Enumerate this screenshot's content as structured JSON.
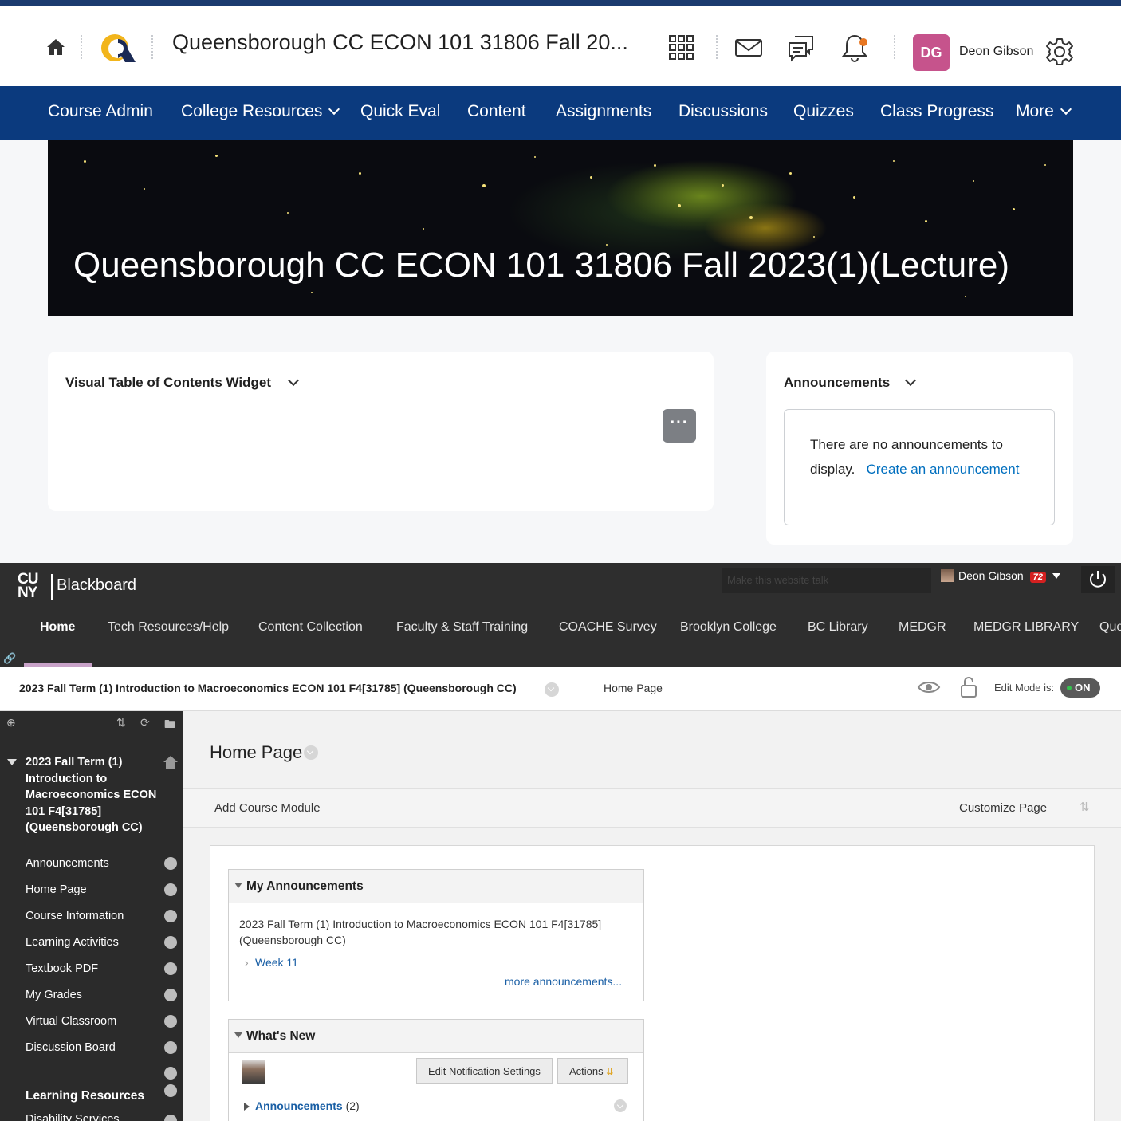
{
  "d2l": {
    "course_title": "Queensborough CC ECON 101 31806 Fall 20...",
    "user_initials": "DG",
    "user_name": "Deon Gibson",
    "nav": [
      "Course Admin",
      "College Resources",
      "Quick Eval",
      "Content",
      "Assignments",
      "Discussions",
      "Quizzes",
      "Class Progress",
      "More"
    ],
    "banner_title": "Queensborough CC ECON 101 31806 Fall 2023(1)(Lecture)",
    "vtoc_title": "Visual Table of Contents Widget",
    "vtoc_more": "···",
    "announcements_title": "Announcements",
    "no_announcements": "There are no announcements to display.",
    "create_link": "Create an announcement",
    "colors": {
      "nav_bg": "#0b3a7e",
      "avatar": "#c6538c",
      "link": "#006fbf"
    }
  },
  "bb": {
    "brand_logo": "CU NY",
    "brand": "Blackboard",
    "talk_placeholder": "Make this website talk",
    "user": "Deon Gibson",
    "badge": "72",
    "tabs": [
      "Home",
      "Tech Resources/Help",
      "Content Collection",
      "Faculty & Staff Training",
      "COACHE Survey",
      "Brooklyn College",
      "BC Library",
      "MEDGR",
      "MEDGR LIBRARY",
      "Que"
    ],
    "breadcrumb_course": "2023 Fall Term (1) Introduction to Macroeconomics ECON 101 F4[31785] (Queensborough CC)",
    "breadcrumb_page": "Home Page",
    "edit_mode_label": "Edit Mode is:",
    "edit_mode_value": "ON",
    "side_course": "2023 Fall Term (1) Introduction to Macroeconomics ECON 101 F4[31785] (Queensborough CC)",
    "side_items": [
      "Announcements",
      "Home Page",
      "Course Information",
      "Learning Activities",
      "Textbook PDF",
      "My Grades",
      "Virtual Classroom",
      "Discussion Board"
    ],
    "side_section": "Learning Resources",
    "side_cut": "Disability Services",
    "page_title": "Home Page",
    "add_module": "Add Course Module",
    "customize": "Customize Page",
    "my_ann_title": "My Announcements",
    "my_ann_course": "2023 Fall Term (1) Introduction to Macroeconomics ECON 101 F4[31785] (Queensborough CC)",
    "my_ann_item": "Week 11",
    "more_ann": "more announcements...",
    "whats_new_title": "What's New",
    "edit_notif": "Edit Notification Settings",
    "actions": "Actions",
    "wn_item": "Announcements",
    "wn_count": "(2)",
    "colors": {
      "top_bg": "#2e2e2e",
      "side_bg": "#2b2b2b",
      "link": "#1a5fa5",
      "badge": "#d42020"
    }
  }
}
